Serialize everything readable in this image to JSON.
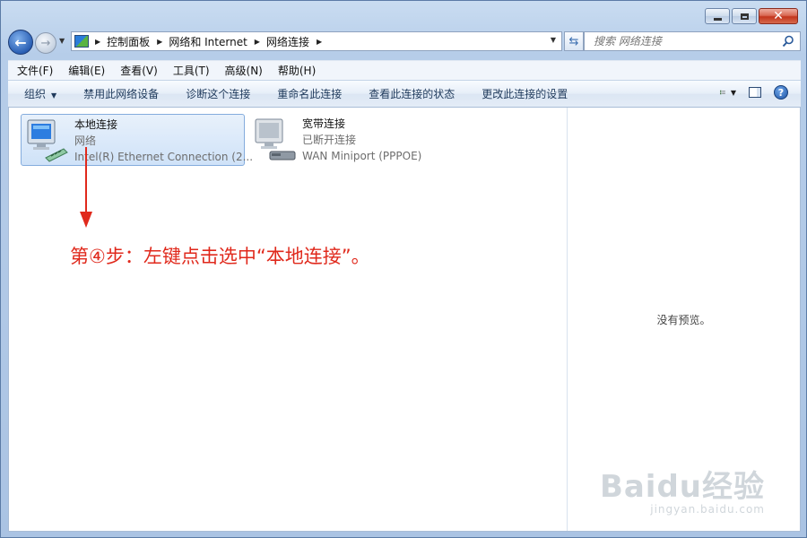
{
  "address": {
    "breadcrumbs": [
      "控制面板",
      "网络和 Internet",
      "网络连接"
    ],
    "search_placeholder": "搜索 网络连接"
  },
  "menu": [
    "文件(F)",
    "编辑(E)",
    "查看(V)",
    "工具(T)",
    "高级(N)",
    "帮助(H)"
  ],
  "commands": {
    "organize": "组织",
    "items": [
      "禁用此网络设备",
      "诊断这个连接",
      "重命名此连接",
      "查看此连接的状态",
      "更改此连接的设置"
    ]
  },
  "connections": [
    {
      "name": "本地连接",
      "status": "网络",
      "device": "Intel(R) Ethernet Connection (2...",
      "selected": true
    },
    {
      "name": "宽带连接",
      "status": "已断开连接",
      "device": "WAN Miniport (PPPOE)",
      "selected": false
    }
  ],
  "preview": {
    "text": "没有预览。"
  },
  "annotation": {
    "text": "第④步：左键点击选中“本地连接”。",
    "color": "#e0291c"
  },
  "watermark": {
    "logo": "Baidu经验",
    "url": "jingyan.baidu.com"
  },
  "colors": {
    "selection": "#cfe2f8",
    "accent": "#1e395b"
  }
}
